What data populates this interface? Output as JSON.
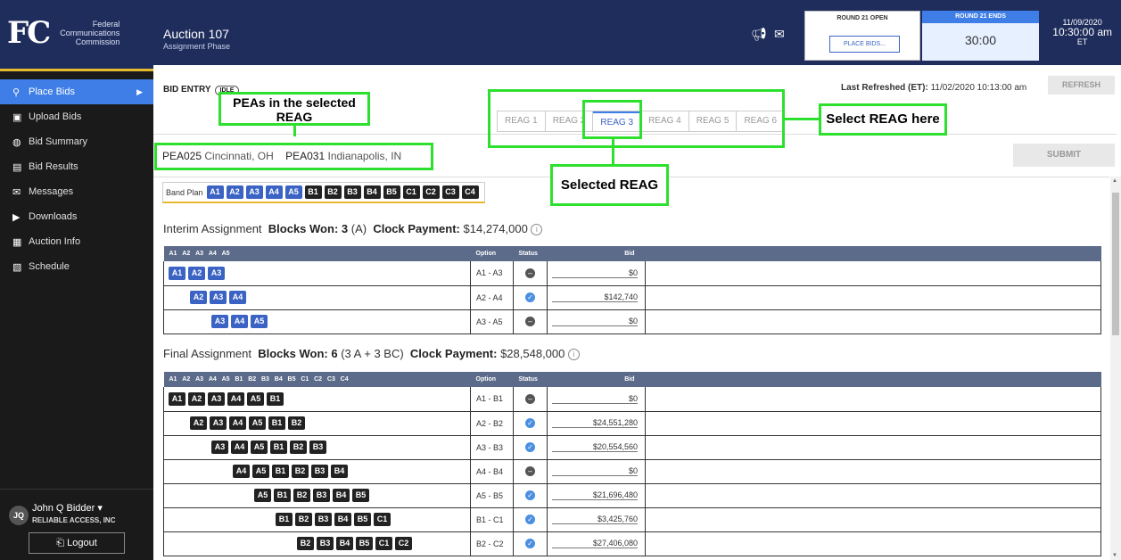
{
  "header": {
    "logo_mark": "FC",
    "logo_text": [
      "Federal",
      "Communications",
      "Commission"
    ],
    "auction_title": "Auction 107",
    "auction_sub": "Assignment Phase",
    "round_open_label": "ROUND 21 OPEN",
    "place_bids_label": "PLACE BIDS...",
    "round_ends_label": "ROUND 21 ENDS",
    "round_ends_time": "30:00",
    "date": "11/09/2020",
    "time": "10:30:00 am",
    "tz": "ET"
  },
  "sidebar": {
    "items": [
      {
        "label": "Place Bids",
        "icon": "gavel-icon",
        "glyph": "⚲"
      },
      {
        "label": "Upload Bids",
        "icon": "upload-icon",
        "glyph": "▣"
      },
      {
        "label": "Bid Summary",
        "icon": "summary-icon",
        "glyph": "◍"
      },
      {
        "label": "Bid Results",
        "icon": "results-icon",
        "glyph": "▤"
      },
      {
        "label": "Messages",
        "icon": "mail-icon",
        "glyph": "✉"
      },
      {
        "label": "Downloads",
        "icon": "download-icon",
        "glyph": "▶"
      },
      {
        "label": "Auction Info",
        "icon": "info-doc-icon",
        "glyph": "▦"
      },
      {
        "label": "Schedule",
        "icon": "calendar-icon",
        "glyph": "▧"
      }
    ],
    "user_initials": "JQ",
    "user_name": "John Q Bidder ▾",
    "user_org": "RELIABLE ACCESS, INC",
    "logout_label": "Logout"
  },
  "main": {
    "bid_entry_label": "BID ENTRY",
    "idle_label": "IDLE",
    "refreshed_label": "Last Refreshed (ET):",
    "refreshed_value": "11/02/2020 10:13:00 am",
    "refresh_btn": "REFRESH",
    "submit_btn": "SUBMIT",
    "reag_tabs": [
      "REAG 1",
      "REAG 2",
      "REAG 3",
      "REAG 4",
      "REAG 5",
      "REAG 6"
    ],
    "pea1_code": "PEA025",
    "pea1_city": "Cincinnati, OH",
    "pea2_code": "PEA031",
    "pea2_city": "Indianapolis, IN",
    "band_plan_label": "Band Plan",
    "band_plan": [
      "A1",
      "A2",
      "A3",
      "A4",
      "A5",
      "B1",
      "B2",
      "B3",
      "B4",
      "B5",
      "C1",
      "C2",
      "C3",
      "C4"
    ],
    "interim": {
      "title": "Interim Assignment",
      "blocks_won_label": "Blocks Won:",
      "blocks_won": "3",
      "blocks_won_detail": "(A)",
      "clock_label": "Clock Payment:",
      "clock_value": "$14,274,000",
      "header_cols": [
        "A1",
        "A2",
        "A3",
        "A4",
        "A5"
      ],
      "rows": [
        {
          "blocks": [
            "A1",
            "A2",
            "A3"
          ],
          "option": "A1 - A3",
          "status": "idle",
          "bid": "$0"
        },
        {
          "blocks": [
            "A2",
            "A3",
            "A4"
          ],
          "option": "A2 - A4",
          "status": "ok",
          "bid": "$142,740"
        },
        {
          "blocks": [
            "A3",
            "A4",
            "A5"
          ],
          "option": "A3 - A5",
          "status": "idle",
          "bid": "$0"
        }
      ]
    },
    "final": {
      "title": "Final Assignment",
      "blocks_won_label": "Blocks Won:",
      "blocks_won": "6",
      "blocks_won_detail": "(3 A + 3 BC)",
      "clock_label": "Clock Payment:",
      "clock_value": "$28,548,000",
      "header_cols": [
        "A1",
        "A2",
        "A3",
        "A4",
        "A5",
        "B1",
        "B2",
        "B3",
        "B4",
        "B5",
        "C1",
        "C2",
        "C3",
        "C4"
      ],
      "rows": [
        {
          "blocks": [
            "A1",
            "A2",
            "A3",
            "A4",
            "A5",
            "B1"
          ],
          "option": "A1 - B1",
          "status": "idle",
          "bid": "$0"
        },
        {
          "blocks": [
            "A2",
            "A3",
            "A4",
            "A5",
            "B1",
            "B2"
          ],
          "option": "A2 - B2",
          "status": "ok",
          "bid": "$24,551,280"
        },
        {
          "blocks": [
            "A3",
            "A4",
            "A5",
            "B1",
            "B2",
            "B3"
          ],
          "option": "A3 - B3",
          "status": "ok",
          "bid": "$20,554,560"
        },
        {
          "blocks": [
            "A4",
            "A5",
            "B1",
            "B2",
            "B3",
            "B4"
          ],
          "option": "A4 - B4",
          "status": "idle",
          "bid": "$0"
        },
        {
          "blocks": [
            "A5",
            "B1",
            "B2",
            "B3",
            "B4",
            "B5"
          ],
          "option": "A5 - B5",
          "status": "ok",
          "bid": "$21,696,480"
        },
        {
          "blocks": [
            "B1",
            "B2",
            "B3",
            "B4",
            "B5",
            "C1"
          ],
          "option": "B1 - C1",
          "status": "ok",
          "bid": "$3,425,760"
        },
        {
          "blocks": [
            "B2",
            "B3",
            "B4",
            "B5",
            "C1",
            "C2"
          ],
          "option": "B2 - C2",
          "status": "ok",
          "bid": "$27,406,080"
        }
      ]
    },
    "col_option": "Option",
    "col_status": "Status",
    "col_bid": "Bid"
  },
  "annotations": {
    "peas": "PEAs in the selected REAG",
    "select_reag": "Select REAG here",
    "selected_reag": "Selected REAG"
  },
  "colors": {
    "header_bg": "#1f2d5c",
    "accent_blue": "#3f7ee6",
    "annotation_green": "#2ee02e",
    "gold": "#e6b92e"
  }
}
